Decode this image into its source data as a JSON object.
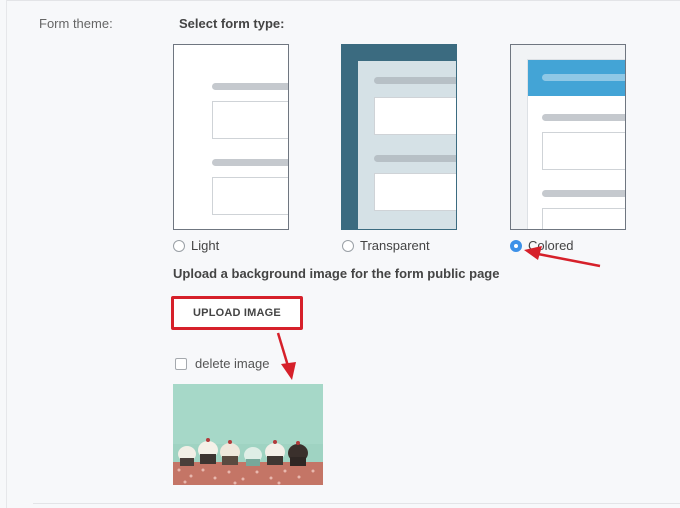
{
  "form_theme": {
    "label": "Form theme:",
    "select_type_title": "Select form type:",
    "options": [
      {
        "label": "Light",
        "selected": false
      },
      {
        "label": "Transparent",
        "selected": false
      },
      {
        "label": "Colored",
        "selected": true
      }
    ]
  },
  "background": {
    "title": "Upload a background image for the form public page",
    "upload_button": "UPLOAD IMAGE",
    "delete_label": "delete image",
    "delete_checked": false
  },
  "colors": {
    "accent_blue": "#3d91e8",
    "transparent_frame": "#3b6b80",
    "colored_header": "#43a4d6",
    "highlight_red": "#d6202a"
  }
}
